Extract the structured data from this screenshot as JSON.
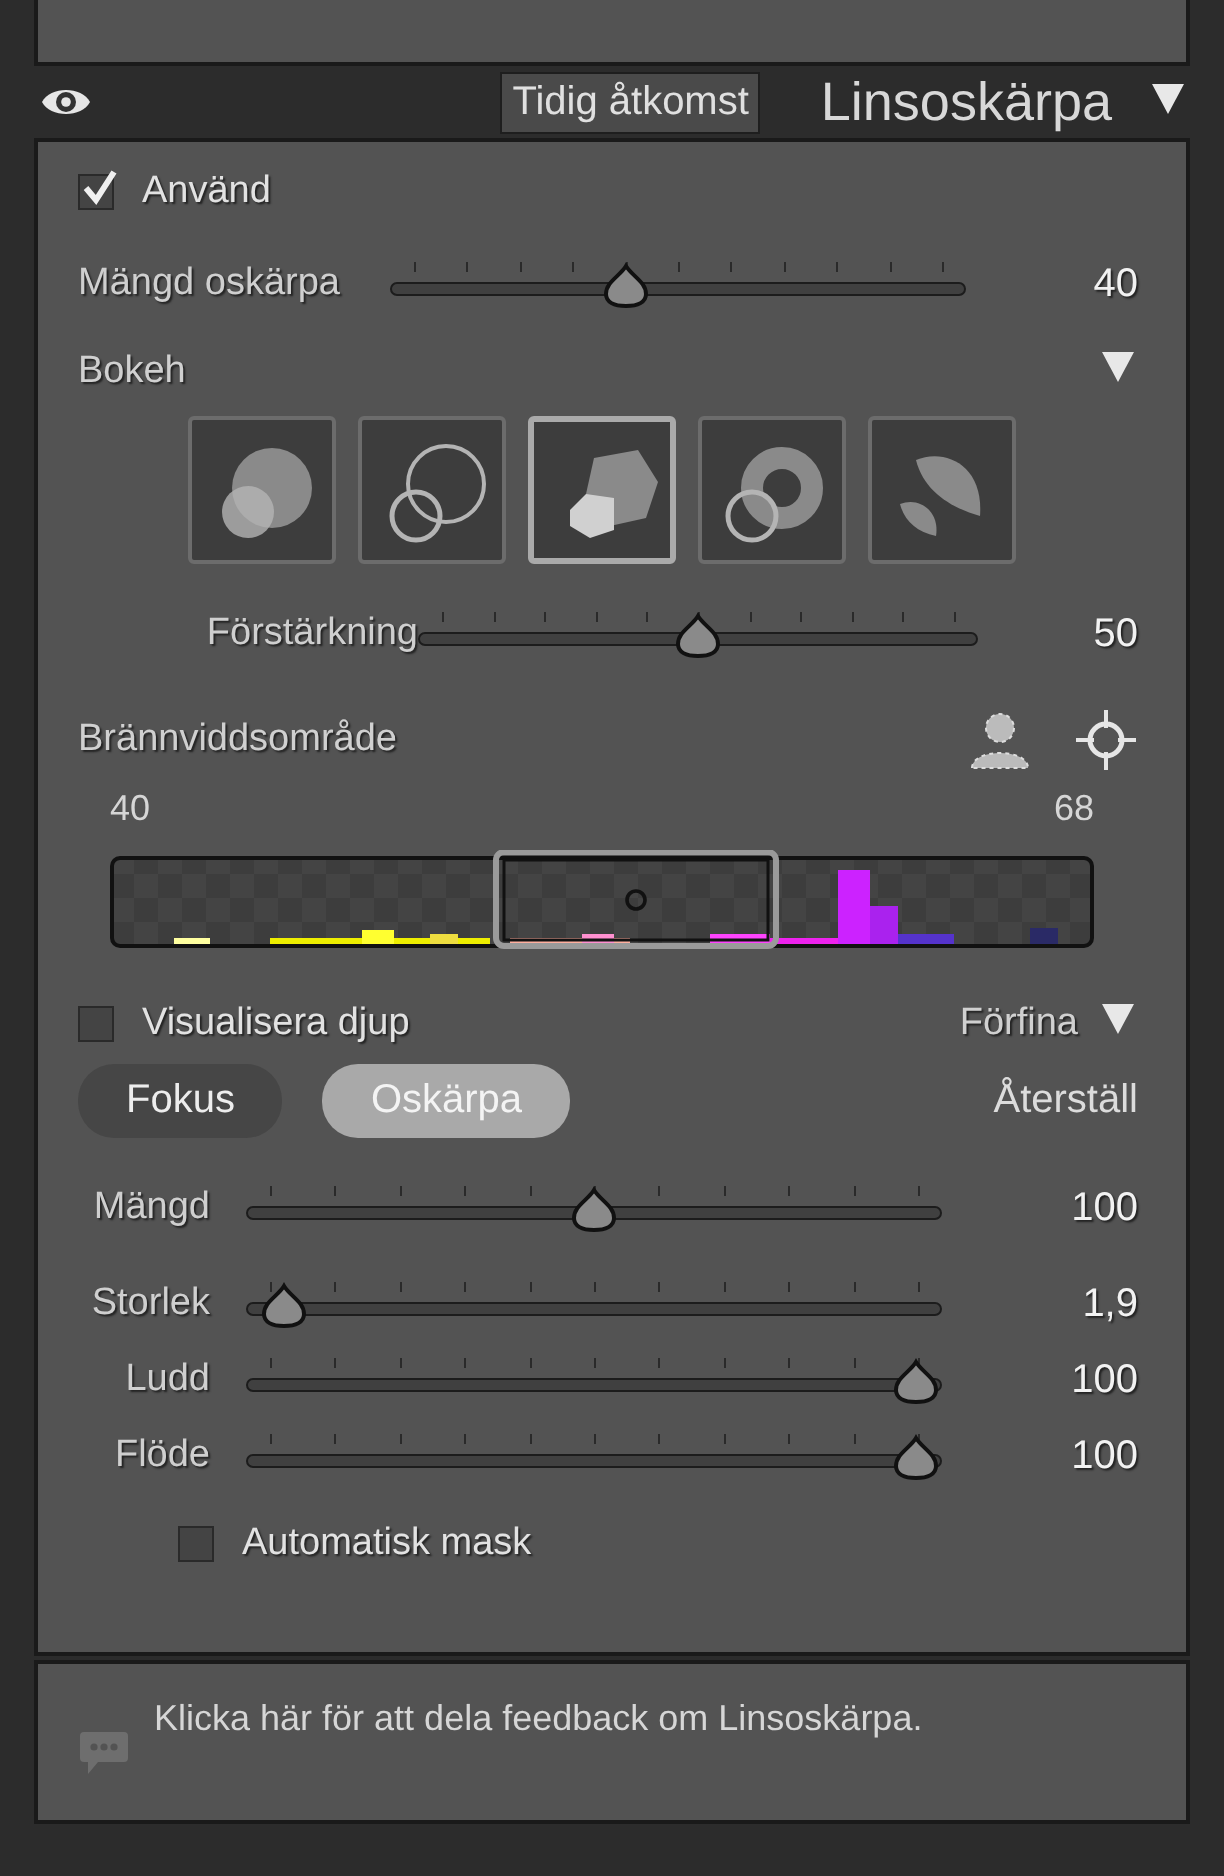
{
  "header": {
    "badge": "Tidig åtkomst",
    "title": "Linsoskärpa",
    "expanded": true
  },
  "apply": {
    "label": "Använd",
    "checked": true
  },
  "blur_amount": {
    "label": "Mängd oskärpa",
    "level": 0.4,
    "reading": "40"
  },
  "bokeh": {
    "title": "Bokeh",
    "expanded": true,
    "shapes": [
      {
        "kind": "circle",
        "selected": false
      },
      {
        "kind": "ring",
        "selected": false
      },
      {
        "kind": "polygon",
        "selected": true
      },
      {
        "kind": "donut",
        "selected": false
      },
      {
        "kind": "petal",
        "selected": false
      }
    ]
  },
  "boost": {
    "label": "Förstärkning",
    "level": 0.5,
    "reading": "50"
  },
  "focal_range": {
    "title": "Brännviddsområde",
    "min_label": "40",
    "max_label": "68"
  },
  "visualize_depth": {
    "label": "Visualisera djup",
    "checked": false
  },
  "refine": {
    "label": "Förfina",
    "expanded": true
  },
  "modes": [
    {
      "label": "Fokus",
      "selected": false
    },
    {
      "label": "Oskärpa",
      "selected": true
    }
  ],
  "reset": "Återställ",
  "refine_sliders": [
    {
      "label": "Mängd",
      "level": 0.5,
      "reading": "100"
    },
    {
      "label": "Storlek",
      "level": 0.02,
      "reading": "1,9"
    },
    {
      "label": "Ludd",
      "level": 1,
      "reading": "100"
    },
    {
      "label": "Flöde",
      "level": 1,
      "reading": "100"
    }
  ],
  "auto_mask": {
    "label": "Automatisk mask",
    "checked": false
  },
  "feedback": "Klicka här för att dela feedback om Linsoskärpa."
}
